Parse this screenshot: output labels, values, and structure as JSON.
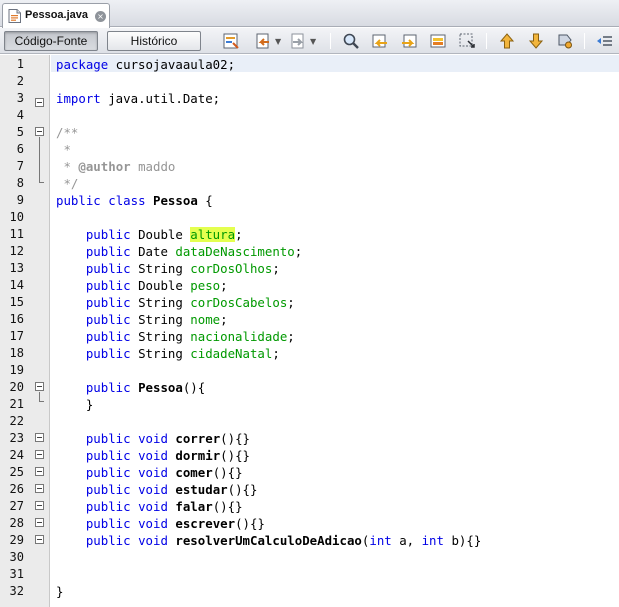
{
  "tab": {
    "label": "Pessoa.java",
    "close_glyph": "×"
  },
  "toolbar": {
    "source_label": "Código-Fonte",
    "history_label": "Histórico",
    "icons": [
      "last-edit-icon",
      "back-icon",
      "forward-icon",
      "find-icon",
      "find-previous-icon",
      "find-next-icon",
      "toggle-highlight-icon",
      "toggle-rectangular-selection-icon",
      "previous-bookmark-icon",
      "next-bookmark-icon",
      "toggle-bookmark-icon",
      "shift-left-icon"
    ]
  },
  "editor": {
    "colors": {
      "keyword": "#0000e6",
      "field": "#009900",
      "comment": "#969696",
      "highlight": "#e4ff4f",
      "current_line": "#e9eff8"
    },
    "line_numbers": [
      "1",
      "2",
      "3",
      "4",
      "5",
      "6",
      "7",
      "8",
      "9",
      "10",
      "11",
      "12",
      "13",
      "14",
      "15",
      "16",
      "17",
      "18",
      "19",
      "20",
      "21",
      "22",
      "23",
      "24",
      "25",
      "26",
      "27",
      "28",
      "29",
      "30",
      "31",
      "32"
    ],
    "lines": [
      [
        {
          "t": "package",
          "c": "kw"
        },
        {
          "t": " cursojavaaula02;"
        }
      ],
      [],
      [
        {
          "t": "import",
          "c": "kw"
        },
        {
          "t": " java.util.Date;"
        }
      ],
      [],
      [
        {
          "t": "/**",
          "c": "cmt"
        }
      ],
      [
        {
          "t": " *",
          "c": "cmt"
        }
      ],
      [
        {
          "t": " * ",
          "c": "cmt"
        },
        {
          "t": "@author",
          "c": "tag"
        },
        {
          "t": " maddo",
          "c": "cmt"
        }
      ],
      [
        {
          "t": " */",
          "c": "cmt"
        }
      ],
      [
        {
          "t": "public",
          "c": "kw"
        },
        {
          "t": " "
        },
        {
          "t": "class",
          "c": "kw"
        },
        {
          "t": " "
        },
        {
          "t": "Pessoa",
          "c": "fn"
        },
        {
          "t": " {"
        }
      ],
      [],
      [
        {
          "t": "    "
        },
        {
          "t": "public",
          "c": "kw"
        },
        {
          "t": " Double "
        },
        {
          "t": "altura",
          "c": "fld hl"
        },
        {
          "t": ";"
        }
      ],
      [
        {
          "t": "    "
        },
        {
          "t": "public",
          "c": "kw"
        },
        {
          "t": " Date "
        },
        {
          "t": "dataDeNascimento",
          "c": "fld"
        },
        {
          "t": ";"
        }
      ],
      [
        {
          "t": "    "
        },
        {
          "t": "public",
          "c": "kw"
        },
        {
          "t": " String "
        },
        {
          "t": "corDosOlhos",
          "c": "fld"
        },
        {
          "t": ";"
        }
      ],
      [
        {
          "t": "    "
        },
        {
          "t": "public",
          "c": "kw"
        },
        {
          "t": " Double "
        },
        {
          "t": "peso",
          "c": "fld"
        },
        {
          "t": ";"
        }
      ],
      [
        {
          "t": "    "
        },
        {
          "t": "public",
          "c": "kw"
        },
        {
          "t": " String "
        },
        {
          "t": "corDosCabelos",
          "c": "fld"
        },
        {
          "t": ";"
        }
      ],
      [
        {
          "t": "    "
        },
        {
          "t": "public",
          "c": "kw"
        },
        {
          "t": " String "
        },
        {
          "t": "nome",
          "c": "fld"
        },
        {
          "t": ";"
        }
      ],
      [
        {
          "t": "    "
        },
        {
          "t": "public",
          "c": "kw"
        },
        {
          "t": " String "
        },
        {
          "t": "nacionalidade",
          "c": "fld"
        },
        {
          "t": ";"
        }
      ],
      [
        {
          "t": "    "
        },
        {
          "t": "public",
          "c": "kw"
        },
        {
          "t": " String "
        },
        {
          "t": "cidadeNatal",
          "c": "fld"
        },
        {
          "t": ";"
        }
      ],
      [],
      [
        {
          "t": "    "
        },
        {
          "t": "public",
          "c": "kw"
        },
        {
          "t": " "
        },
        {
          "t": "Pessoa",
          "c": "fn"
        },
        {
          "t": "(){"
        }
      ],
      [
        {
          "t": "    }"
        }
      ],
      [],
      [
        {
          "t": "    "
        },
        {
          "t": "public",
          "c": "kw"
        },
        {
          "t": " "
        },
        {
          "t": "void",
          "c": "kw"
        },
        {
          "t": " "
        },
        {
          "t": "correr",
          "c": "fn"
        },
        {
          "t": "(){}"
        }
      ],
      [
        {
          "t": "    "
        },
        {
          "t": "public",
          "c": "kw"
        },
        {
          "t": " "
        },
        {
          "t": "void",
          "c": "kw"
        },
        {
          "t": " "
        },
        {
          "t": "dormir",
          "c": "fn"
        },
        {
          "t": "(){}"
        }
      ],
      [
        {
          "t": "    "
        },
        {
          "t": "public",
          "c": "kw"
        },
        {
          "t": " "
        },
        {
          "t": "void",
          "c": "kw"
        },
        {
          "t": " "
        },
        {
          "t": "comer",
          "c": "fn"
        },
        {
          "t": "(){}"
        }
      ],
      [
        {
          "t": "    "
        },
        {
          "t": "public",
          "c": "kw"
        },
        {
          "t": " "
        },
        {
          "t": "void",
          "c": "kw"
        },
        {
          "t": " "
        },
        {
          "t": "estudar",
          "c": "fn"
        },
        {
          "t": "(){}"
        }
      ],
      [
        {
          "t": "    "
        },
        {
          "t": "public",
          "c": "kw"
        },
        {
          "t": " "
        },
        {
          "t": "void",
          "c": "kw"
        },
        {
          "t": " "
        },
        {
          "t": "falar",
          "c": "fn"
        },
        {
          "t": "(){}"
        }
      ],
      [
        {
          "t": "    "
        },
        {
          "t": "public",
          "c": "kw"
        },
        {
          "t": " "
        },
        {
          "t": "void",
          "c": "kw"
        },
        {
          "t": " "
        },
        {
          "t": "escrever",
          "c": "fn"
        },
        {
          "t": "(){}"
        }
      ],
      [
        {
          "t": "    "
        },
        {
          "t": "public",
          "c": "kw"
        },
        {
          "t": " "
        },
        {
          "t": "void",
          "c": "kw"
        },
        {
          "t": " "
        },
        {
          "t": "resolverUmCalculoDeAdicao",
          "c": "fn"
        },
        {
          "t": "("
        },
        {
          "t": "int",
          "c": "kw"
        },
        {
          "t": " a, "
        },
        {
          "t": "int",
          "c": "kw"
        },
        {
          "t": " b){}"
        }
      ],
      [],
      [],
      [
        {
          "t": "}"
        }
      ]
    ]
  }
}
